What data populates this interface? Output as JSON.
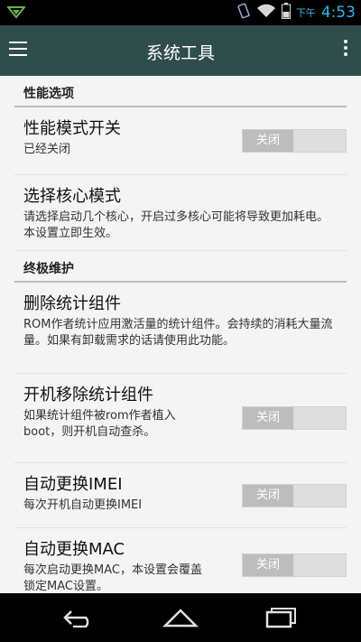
{
  "status": {
    "ampm": "下午",
    "time": "4:53"
  },
  "app": {
    "title": "系统工具"
  },
  "sections": [
    {
      "header": "性能选项",
      "items": [
        {
          "title": "性能模式开关",
          "summary": "已经关闭",
          "toggle": "关闭"
        },
        {
          "title": "选择核心模式",
          "summary": "请选择启动几个核心，开启过多核心可能将导致更加耗电。本设置立即生效。"
        }
      ]
    },
    {
      "header": "终极维护",
      "items": [
        {
          "title": "删除统计组件",
          "summary": "ROM作者统计应用激活量的统计组件。会持续的消耗大量流量。如果有卸载需求的话请使用此功能。"
        },
        {
          "title": "开机移除统计组件",
          "summary": "如果统计组件被rom作者植入boot，则开机自动查杀。",
          "toggle": "关闭"
        },
        {
          "title": "自动更换IMEI",
          "summary": "每次开机自动更换IMEI",
          "toggle": "关闭"
        },
        {
          "title": "自动更换MAC",
          "summary": "每次启动更换MAC，本设置会覆盖锁定MAC设置。",
          "toggle": "关闭"
        }
      ]
    }
  ],
  "colors": {
    "action_bar": "#2f4d4b",
    "status_accent": "#33b5e5",
    "toggle_off": "#bdbdbd"
  },
  "icons": [
    "notification-icon",
    "vibrate-icon",
    "wifi-icon",
    "battery-icon",
    "menu-icon",
    "overflow-icon",
    "back-icon",
    "home-icon",
    "recents-icon"
  ]
}
